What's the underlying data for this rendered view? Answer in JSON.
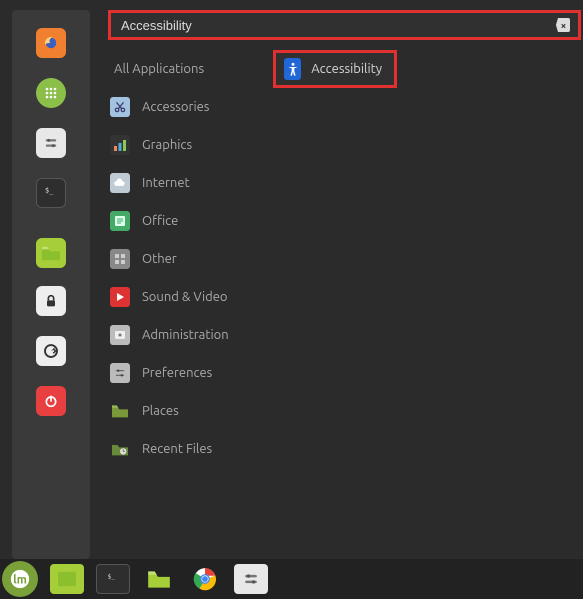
{
  "search": {
    "value": "Accessibility"
  },
  "categories": [
    {
      "label": "All Applications"
    },
    {
      "label": "Accessories"
    },
    {
      "label": "Graphics"
    },
    {
      "label": "Internet"
    },
    {
      "label": "Office"
    },
    {
      "label": "Other"
    },
    {
      "label": "Sound & Video"
    },
    {
      "label": "Administration"
    },
    {
      "label": "Preferences"
    },
    {
      "label": "Places"
    },
    {
      "label": "Recent Files"
    }
  ],
  "results": [
    {
      "label": "Accessibility"
    }
  ]
}
